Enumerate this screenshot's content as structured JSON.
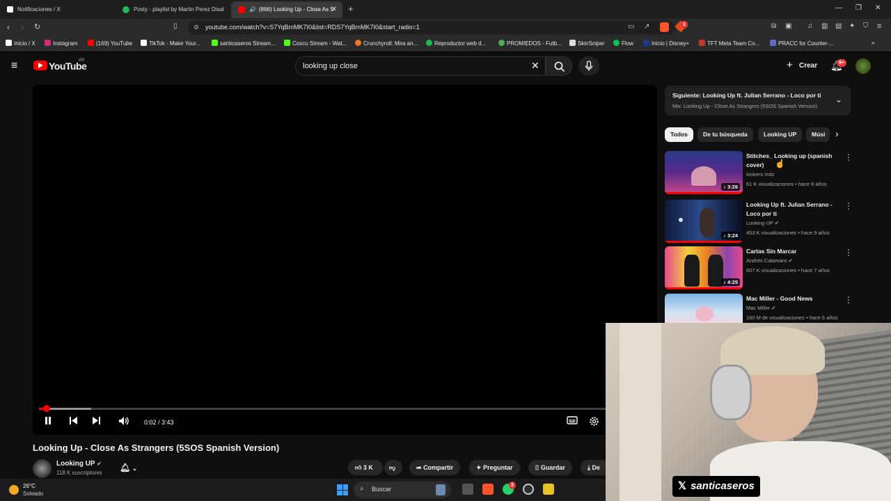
{
  "browser": {
    "tabs": [
      {
        "title": "Notificaciones / X",
        "icon": "x-logo-icon"
      },
      {
        "title": "Posty - playlist by Martin Perez Disal",
        "icon": "spotify-icon"
      },
      {
        "title": "(866) Looking Up - Close As S",
        "icon": "youtube-icon",
        "active": true
      }
    ],
    "new_tab_label": "+",
    "url": "youtube.com/watch?v=S7YqBmMK7I0&list=RDS7YqBmMK7I0&start_radio=1",
    "notification_count": "1",
    "bookmarks": [
      {
        "label": "Inicio / X",
        "color": "#ffffff"
      },
      {
        "label": "Instagram",
        "color": "#d62976"
      },
      {
        "label": "(169) YouTube",
        "color": "#ff0000"
      },
      {
        "label": "TikTok - Make Your...",
        "color": "#ffffff"
      },
      {
        "label": "santicaseros Stream...",
        "color": "#53fc18"
      },
      {
        "label": "Coscu Stream - Wat...",
        "color": "#53fc18"
      },
      {
        "label": "Crunchyroll: Mira an...",
        "color": "#f47521"
      },
      {
        "label": "Reproductor web d...",
        "color": "#1db954"
      },
      {
        "label": "PROMIEDOS - Futb...",
        "color": "#4caf50"
      },
      {
        "label": "SkinSniper",
        "color": "#dddddd"
      },
      {
        "label": "Flow",
        "color": "#00c853"
      },
      {
        "label": "Inicio | Disney+",
        "color": "#1a3a8a"
      },
      {
        "label": "TFT Meta Team Co...",
        "color": "#c0392b"
      },
      {
        "label": "PRACC for Counter-...",
        "color": "#5c6bc0"
      }
    ]
  },
  "youtube": {
    "logo_text": "YouTube",
    "region": "AR",
    "search_value": "looking up close",
    "create_label": "Crear",
    "notif_badge": "9+"
  },
  "player": {
    "time": "0:02 / 3:43",
    "progress_fraction": 0.009,
    "buffer_fraction": 0.085
  },
  "video": {
    "title": "Looking Up - Close As Strangers (5SOS Spanish Version)",
    "channel": "Looking UP",
    "subscribers": "118 K suscriptores",
    "likes": "3 K",
    "share_label": "Compartir",
    "ask_label": "Preguntar",
    "save_label": "Guardar",
    "download_label": "De"
  },
  "up_next": {
    "line1": "Siguiente: Looking Up ft. Julian Serrano - Loco por ti",
    "line2": "Mix: Looking Up - Close As Strangers (5SOS Spanish Version)"
  },
  "chips": [
    "Todos",
    "De tu búsqueda",
    "Looking UP",
    "Músi"
  ],
  "recommendations": [
    {
      "title": "Stitches_ Looking up (spanish cover)",
      "channel": "lookers mdz",
      "meta": "61 K visualizaciones • hace 8 años",
      "duration": "3:26",
      "verified": false
    },
    {
      "title": "Looking Up ft. Julian Serrano - Loco por ti",
      "channel": "Looking UP",
      "meta": "453 K visualizaciones • hace 9 años",
      "duration": "3:24",
      "verified": true
    },
    {
      "title": "Cartas Sin Marcar",
      "channel": "Andrés Calamaro",
      "meta": "607 K visualizaciones • hace 7 años",
      "duration": "4:25",
      "verified": true
    },
    {
      "title": "Mac Miller - Good News",
      "channel": "Mac Miller",
      "meta": "160 M de visualizaciones • hace 6 años",
      "duration": "",
      "verified": true
    }
  ],
  "overlay": {
    "watermark": "santicaseros"
  },
  "taskbar": {
    "temperature": "26°C",
    "weather": "Soleado",
    "search_placeholder": "Buscar",
    "whatsapp_badge": "3"
  }
}
